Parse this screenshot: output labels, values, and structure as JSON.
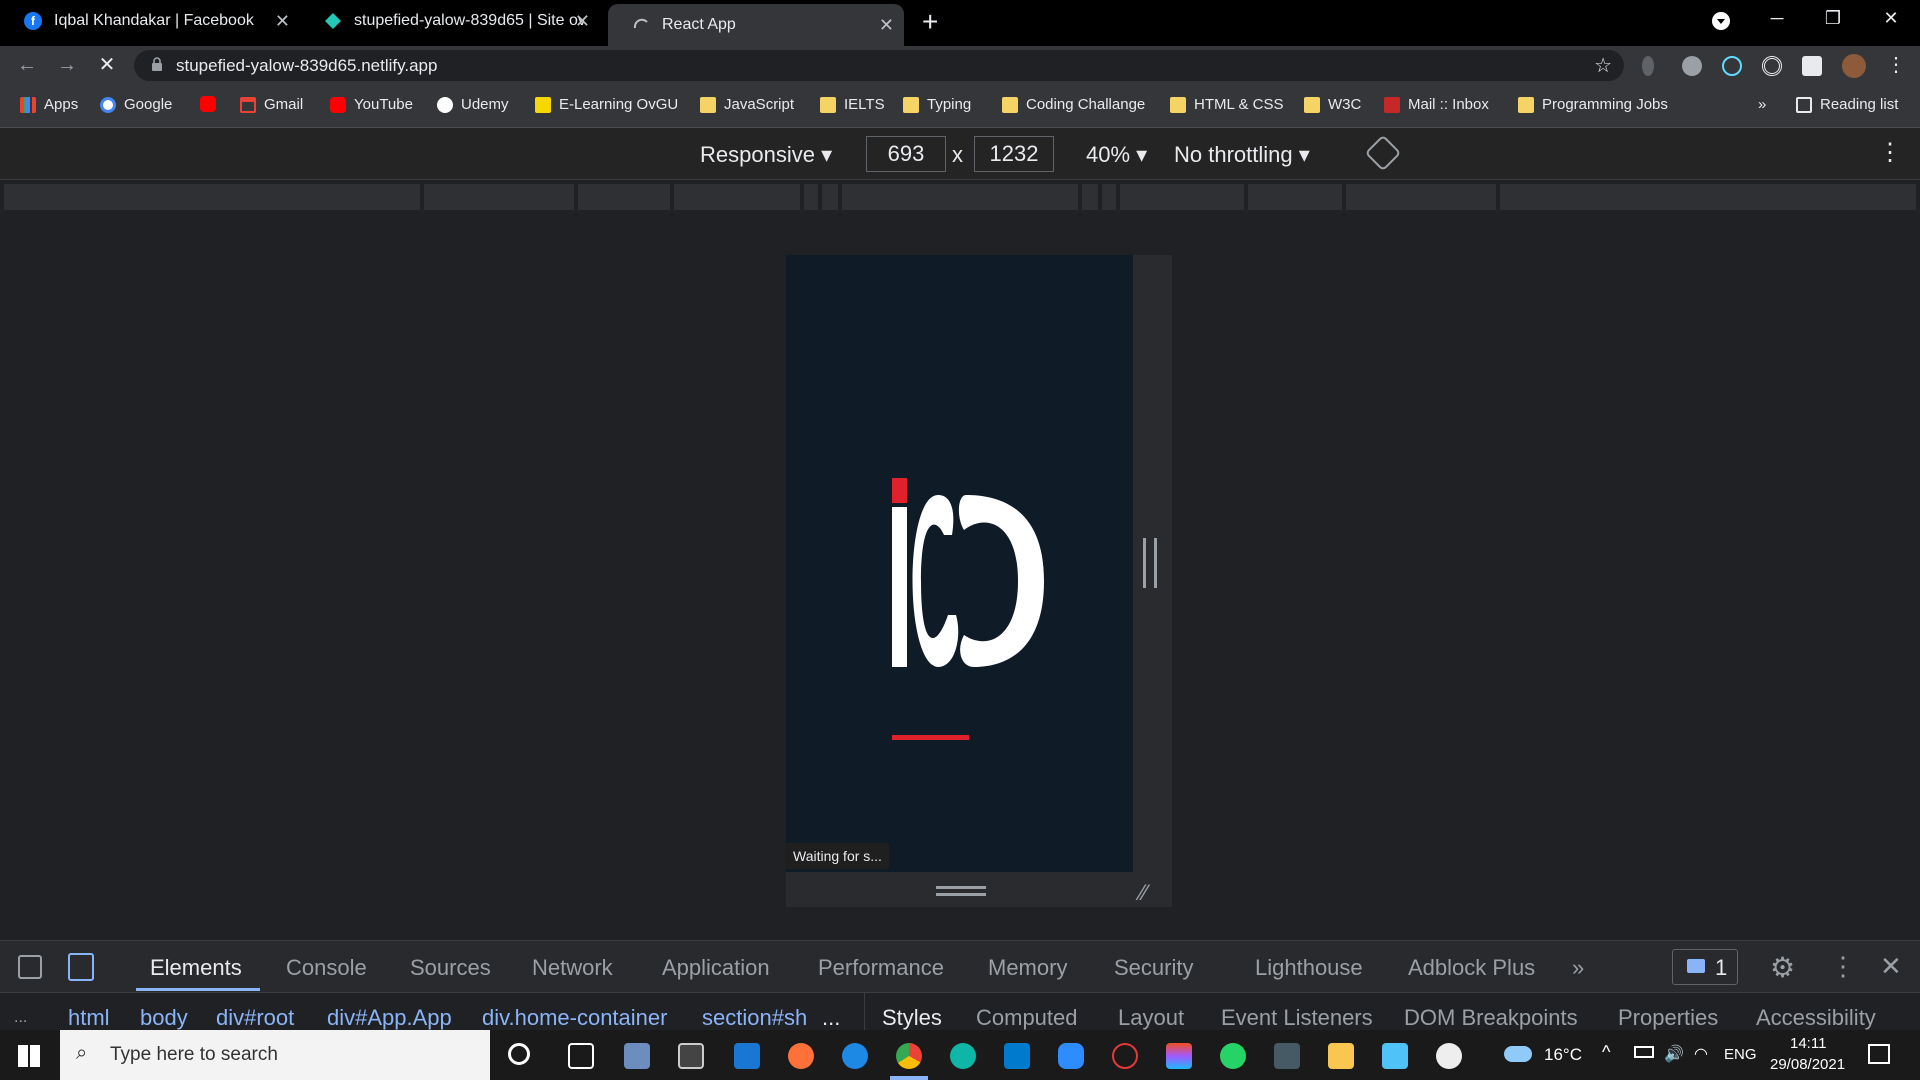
{
  "browser": {
    "tabs": [
      {
        "title": "Iqbal Khandakar | Facebook",
        "icon": "facebook-icon",
        "active": false
      },
      {
        "title": "stupefied-yalow-839d65 | Site ov",
        "icon": "netlify-icon",
        "active": false
      },
      {
        "title": "React App",
        "icon": "loading-icon",
        "active": true
      }
    ],
    "new_tab_symbol": "+",
    "url": "stupefied-yalow-839d65.netlify.app",
    "bookmarks": [
      {
        "label": "Apps",
        "icon": "apps-grid-icon"
      },
      {
        "label": "Google",
        "icon": "google-icon"
      },
      {
        "label": "",
        "icon": "youtube-icon"
      },
      {
        "label": "Gmail",
        "icon": "gmail-icon"
      },
      {
        "label": "YouTube",
        "icon": "youtube-icon"
      },
      {
        "label": "Udemy",
        "icon": "udemy-icon"
      },
      {
        "label": "E-Learning OvGU",
        "icon": "elearning-icon"
      },
      {
        "label": "JavaScript",
        "icon": "folder-icon"
      },
      {
        "label": "IELTS",
        "icon": "folder-icon"
      },
      {
        "label": "Typing",
        "icon": "folder-icon"
      },
      {
        "label": "Coding Challange",
        "icon": "folder-icon"
      },
      {
        "label": "HTML & CSS",
        "icon": "folder-icon"
      },
      {
        "label": "W3C",
        "icon": "folder-icon"
      },
      {
        "label": "Mail :: Inbox",
        "icon": "mail-icon"
      },
      {
        "label": "Programming Jobs",
        "icon": "folder-icon"
      }
    ],
    "bookmarks_overflow": "»",
    "reading_list": "Reading list"
  },
  "device_toolbar": {
    "mode": "Responsive",
    "width": "693",
    "times": "x",
    "height": "1232",
    "zoom": "40%",
    "throttling": "No throttling"
  },
  "viewport": {
    "status_text": "Waiting for s...",
    "colors": {
      "background": "#0f1b26",
      "accent": "#e0202a",
      "logo": "#ffffff"
    }
  },
  "devtools": {
    "tabs": [
      "Elements",
      "Console",
      "Sources",
      "Network",
      "Application",
      "Performance",
      "Memory",
      "Security",
      "Lighthouse",
      "Adblock Plus"
    ],
    "active_tab": "Elements",
    "more_tabs": "»",
    "issues_count": "1",
    "breadcrumbs": [
      "html",
      "body",
      "div#root",
      "div#App.App",
      "div.home-container",
      "section#sh"
    ],
    "crumbs_more": "...",
    "crumbs_left": "...",
    "sidebar_tabs": [
      "Styles",
      "Computed",
      "Layout",
      "Event Listeners",
      "DOM Breakpoints",
      "Properties",
      "Accessibility"
    ]
  },
  "taskbar": {
    "search_placeholder": "Type here to search",
    "temperature": "16°C",
    "language": "ENG",
    "time": "14:11",
    "date": "29/08/2021"
  }
}
